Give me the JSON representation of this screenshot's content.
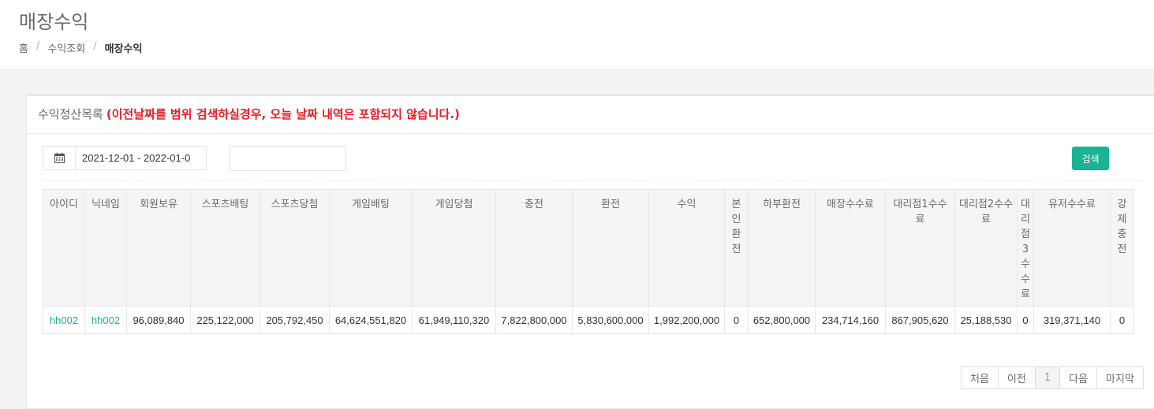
{
  "header": {
    "title": "매장수익",
    "breadcrumb": [
      "홈",
      "수익조회",
      "매장수익"
    ]
  },
  "panel": {
    "title": "수익정산목록",
    "notice": "(이전날짜를 범위 검색하실경우, 오늘 날짜 내역은 포함되지 않습니다.)"
  },
  "filters": {
    "date_range": "2021-12-01 - 2022-01-0",
    "search_value": "",
    "search_button": "검색"
  },
  "table": {
    "columns": [
      "아이디",
      "닉네임",
      "회원보유",
      "스포츠배팅",
      "스포츠당첨",
      "게임배팅",
      "게임당첨",
      "충전",
      "환전",
      "수익",
      "본인환전",
      "하부환전",
      "매장수수료",
      "대리점1수수료",
      "대리점2수수료",
      "대리점3수수료",
      "유저수수료",
      "강제충전"
    ],
    "rows": [
      [
        "hh002",
        "hh002",
        "96,089,840",
        "225,122,000",
        "205,792,450",
        "64,624,551,820",
        "61,949,110,320",
        "7,822,800,000",
        "5,830,600,000",
        "1,992,200,000",
        "0",
        "652,800,000",
        "234,714,160",
        "867,905,620",
        "25,188,530",
        "0",
        "319,371,140",
        "0"
      ]
    ]
  },
  "pagination": {
    "first": "처음",
    "prev": "이전",
    "current": "1",
    "next": "다음",
    "last": "마지막"
  },
  "colors": {
    "accent": "#1ab394",
    "notice": "#ed1c24"
  }
}
